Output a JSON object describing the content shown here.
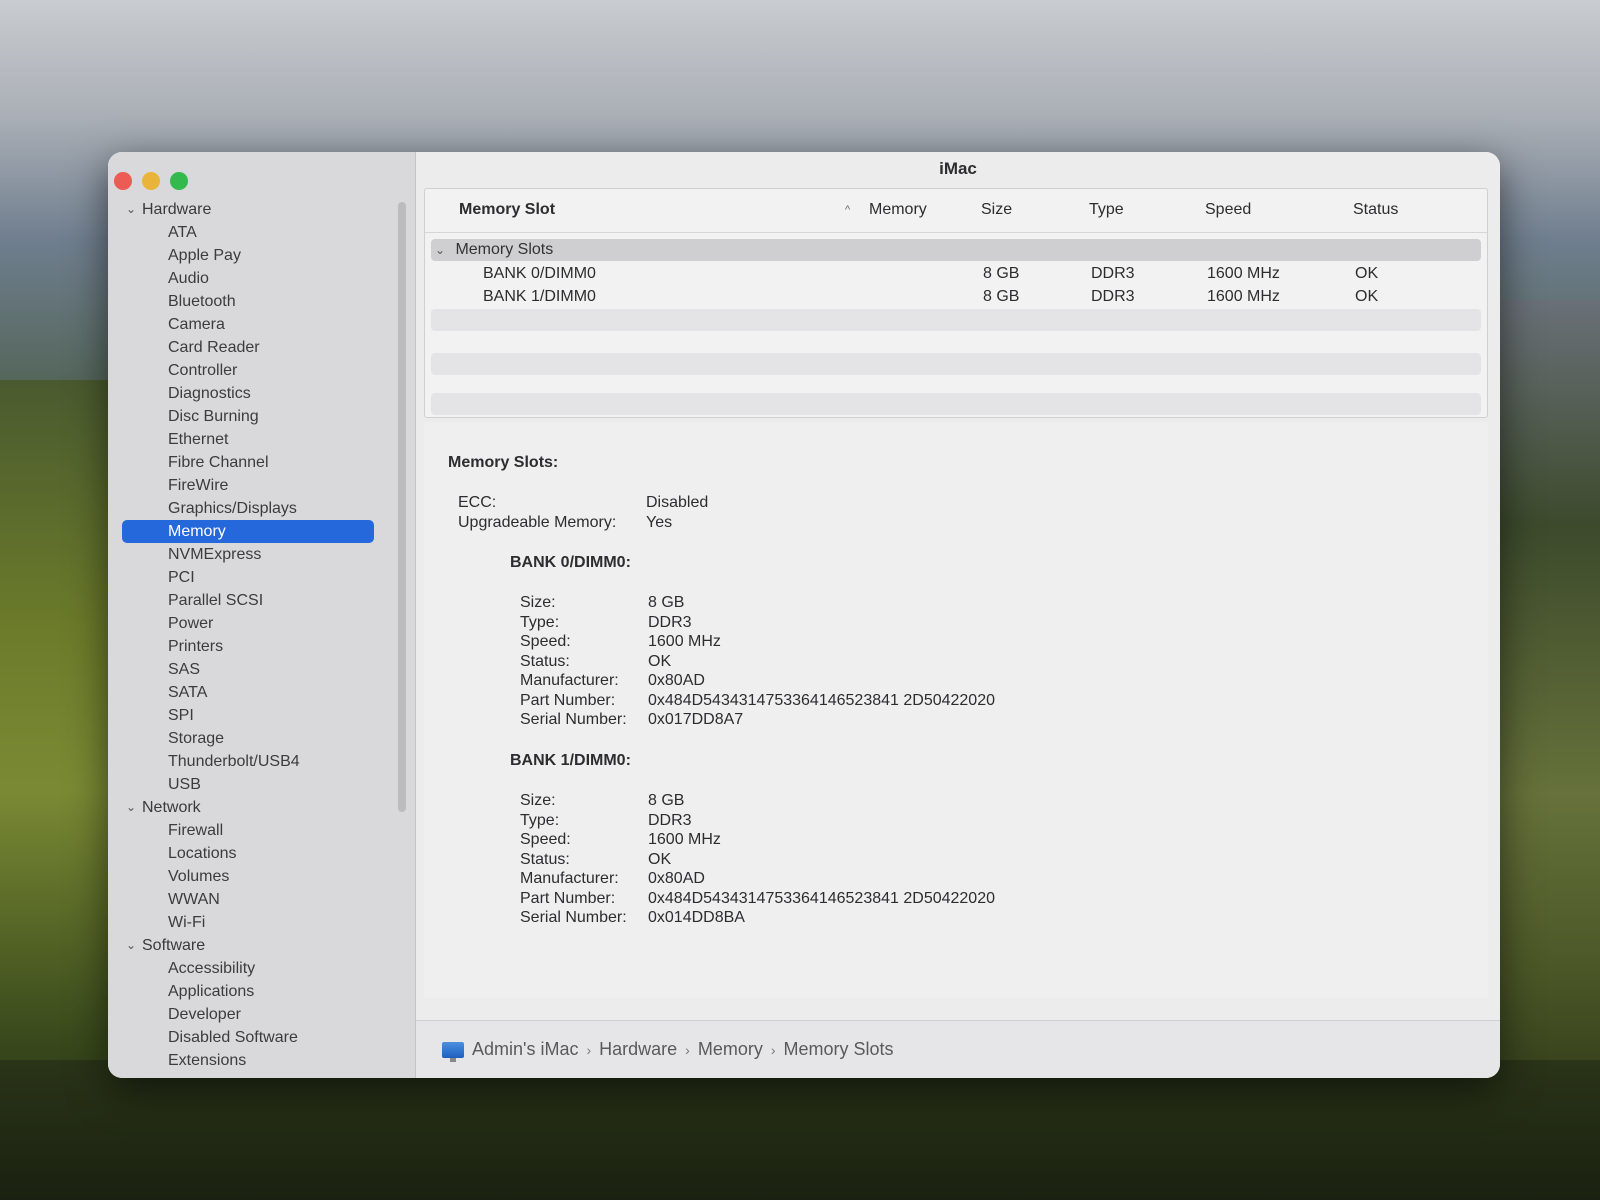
{
  "window": {
    "title": "iMac"
  },
  "sidebar": {
    "groups": [
      {
        "label": "Hardware",
        "items": [
          "ATA",
          "Apple Pay",
          "Audio",
          "Bluetooth",
          "Camera",
          "Card Reader",
          "Controller",
          "Diagnostics",
          "Disc Burning",
          "Ethernet",
          "Fibre Channel",
          "FireWire",
          "Graphics/Displays",
          "Memory",
          "NVMExpress",
          "PCI",
          "Parallel SCSI",
          "Power",
          "Printers",
          "SAS",
          "SATA",
          "SPI",
          "Storage",
          "Thunderbolt/USB4",
          "USB"
        ]
      },
      {
        "label": "Network",
        "items": [
          "Firewall",
          "Locations",
          "Volumes",
          "WWAN",
          "Wi-Fi"
        ]
      },
      {
        "label": "Software",
        "items": [
          "Accessibility",
          "Applications",
          "Developer",
          "Disabled Software",
          "Extensions"
        ]
      }
    ],
    "selected": "Memory"
  },
  "table": {
    "headers": {
      "slot": "Memory Slot",
      "memory": "Memory",
      "size": "Size",
      "type": "Type",
      "speed": "Speed",
      "status": "Status"
    },
    "group": "Memory Slots",
    "rows": [
      {
        "slot": "BANK 0/DIMM0",
        "size": "8 GB",
        "type": "DDR3",
        "speed": "1600 MHz",
        "status": "OK"
      },
      {
        "slot": "BANK 1/DIMM0",
        "size": "8 GB",
        "type": "DDR3",
        "speed": "1600 MHz",
        "status": "OK"
      }
    ]
  },
  "detail": {
    "heading": "Memory Slots:",
    "ecc_label": "ECC:",
    "ecc_value": "Disabled",
    "upgradeable_label": "Upgradeable Memory:",
    "upgradeable_value": "Yes",
    "banks": [
      {
        "title": "BANK 0/DIMM0:",
        "fields": [
          {
            "k": "Size:",
            "v": "8 GB"
          },
          {
            "k": "Type:",
            "v": "DDR3"
          },
          {
            "k": "Speed:",
            "v": "1600 MHz"
          },
          {
            "k": "Status:",
            "v": "OK"
          },
          {
            "k": "Manufacturer:",
            "v": "0x80AD"
          },
          {
            "k": "Part Number:",
            "v": "0x484D5434314753364146523841 2D50422020"
          },
          {
            "k": "Serial Number:",
            "v": "0x017DD8A7"
          }
        ]
      },
      {
        "title": "BANK 1/DIMM0:",
        "fields": [
          {
            "k": "Size:",
            "v": "8 GB"
          },
          {
            "k": "Type:",
            "v": "DDR3"
          },
          {
            "k": "Speed:",
            "v": "1600 MHz"
          },
          {
            "k": "Status:",
            "v": "OK"
          },
          {
            "k": "Manufacturer:",
            "v": "0x80AD"
          },
          {
            "k": "Part Number:",
            "v": "0x484D5434314753364146523841 2D50422020"
          },
          {
            "k": "Serial Number:",
            "v": "0x014DD8BA"
          }
        ]
      }
    ]
  },
  "pathbar": {
    "items": [
      "Admin's iMac",
      "Hardware",
      "Memory",
      "Memory Slots"
    ]
  }
}
